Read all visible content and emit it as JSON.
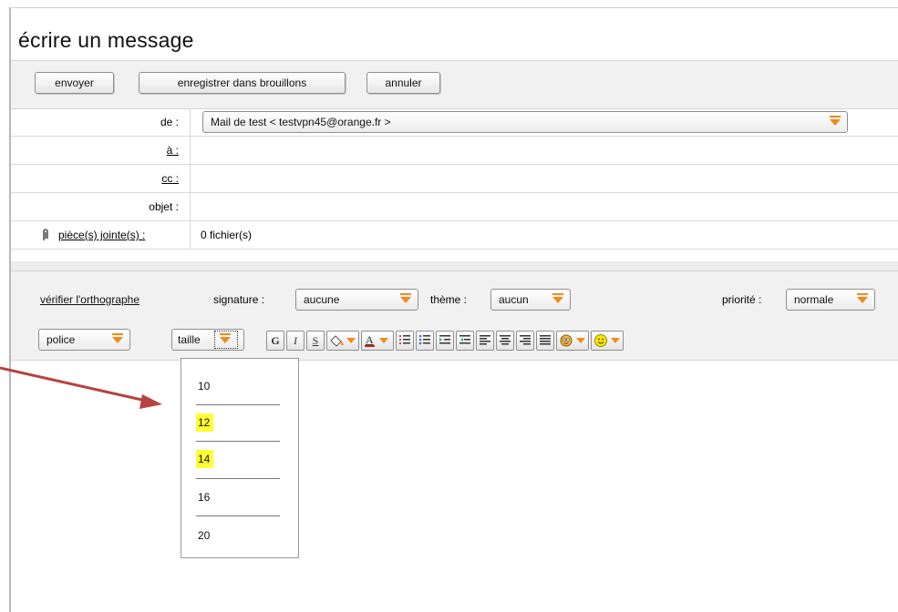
{
  "header": {
    "title": "écrire un message"
  },
  "actions": {
    "send_label": "envoyer",
    "save_draft_label": "enregistrer dans brouillons",
    "cancel_label": "annuler"
  },
  "fields": {
    "from_label": "de :",
    "from_value": "Mail de test < testvpn45@orange.fr >",
    "to_label": "à :",
    "cc_label": "cc :",
    "subject_label": "objet :",
    "attachments_label": "pièce(s) jointe(s) :",
    "attachments_value": "0 fichier(s)"
  },
  "editor": {
    "spellcheck_label": "vérifier l'orthographe",
    "signature_label": "signature :",
    "signature_value": "aucune",
    "theme_label": "thème :",
    "theme_value": "aucun",
    "priority_label": "priorité :",
    "priority_value": "normale",
    "font_label": "police",
    "size_label": "taille",
    "bold_glyph": "G",
    "italic_glyph": "I",
    "underline_glyph": "S"
  },
  "size_menu": {
    "options": [
      "10",
      "12",
      "14",
      "16",
      "20"
    ],
    "highlighted": [
      "12",
      "14"
    ]
  },
  "colors": {
    "accent_arrow": "#f28a1a",
    "highlight": "#ffff33",
    "annotation_arrow": "#b5443f"
  },
  "icons": [
    "paperclip-icon",
    "paint-bucket-icon",
    "text-color-icon",
    "numbered-list-icon",
    "bullet-list-icon",
    "indent-icon",
    "outdent-icon",
    "align-left-icon",
    "align-center-icon",
    "align-right-icon",
    "justify-icon",
    "emoticon-face-icon",
    "smiley-icon"
  ]
}
